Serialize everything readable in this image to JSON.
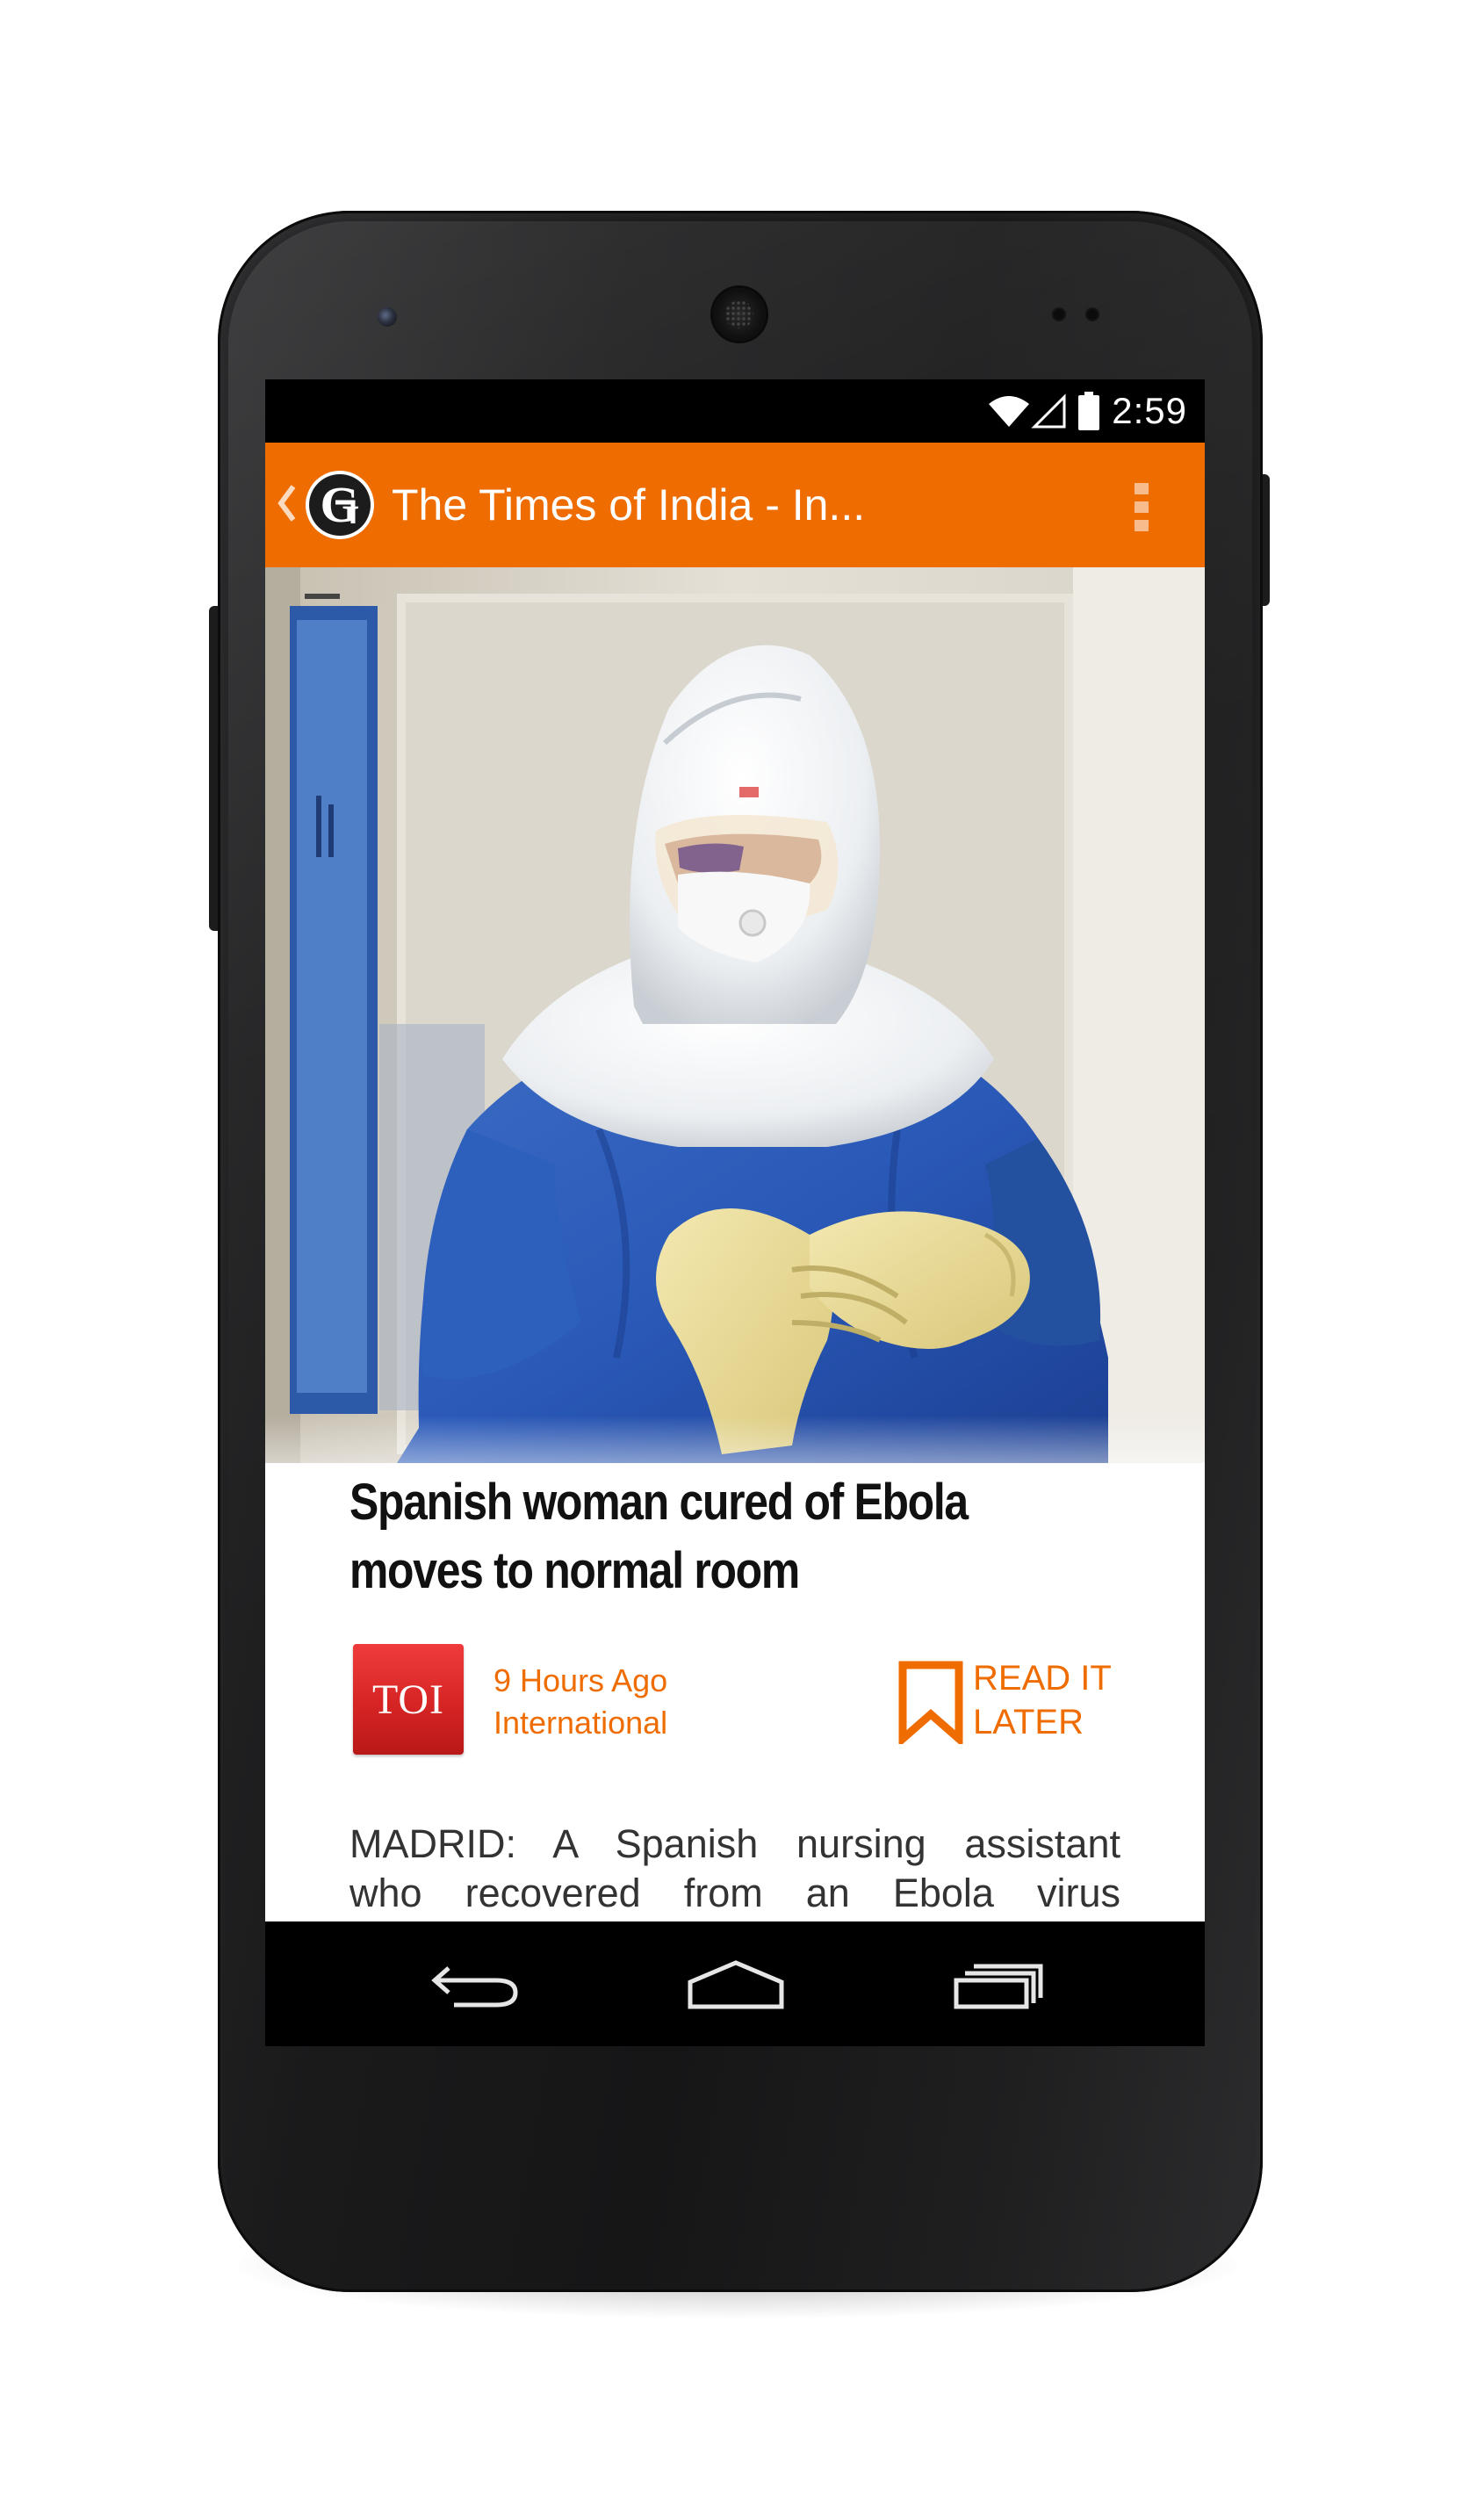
{
  "status_bar": {
    "time": "2:59",
    "icons": [
      "wifi-icon",
      "signal-icon",
      "battery-icon"
    ]
  },
  "action_bar": {
    "title": "The Times of India - In...",
    "logo_icon": "newspaper-g-logo-icon",
    "menu_icon": "overflow-menu-icon",
    "background": "#ef6c00"
  },
  "article": {
    "headline_line1": "Spanish woman cured of Ebola",
    "headline_line2": "moves to normal room",
    "source_logo_text": "TOI",
    "time_ago": "9 Hours Ago",
    "category": "International",
    "read_later_line1": "READ IT",
    "read_later_line2": "LATER",
    "body_line1": "MADRID: A Spanish nursing assistant",
    "body_line2": "who recovered from an Ebola virus"
  },
  "navigation": {
    "buttons": [
      "back-icon",
      "home-icon",
      "recent-apps-icon"
    ]
  },
  "colors": {
    "accent": "#ef6c00",
    "source_logo": "#d62424"
  }
}
